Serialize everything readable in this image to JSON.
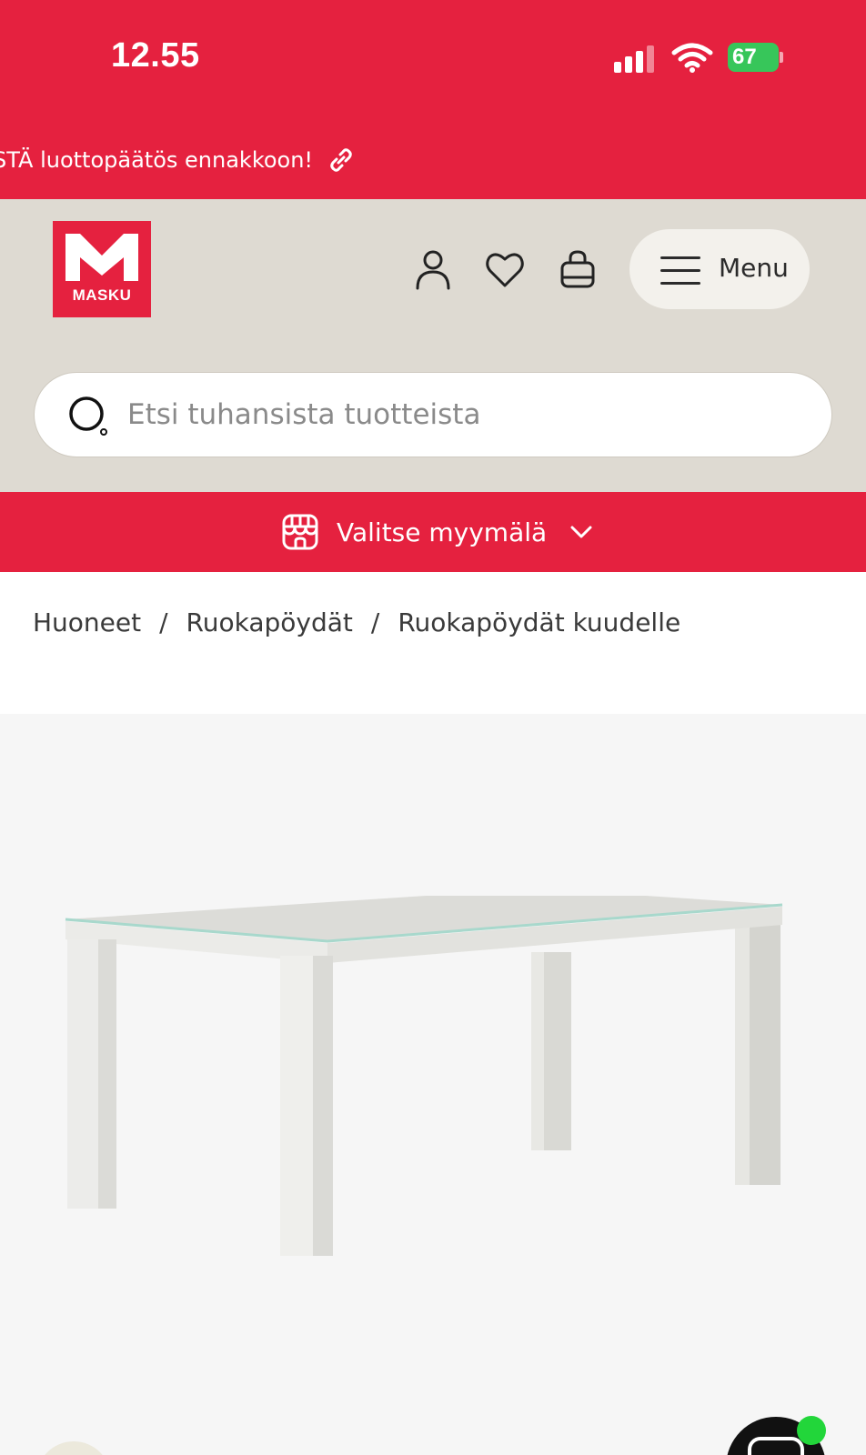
{
  "status_bar": {
    "time": "12.55",
    "battery": "67"
  },
  "promo": {
    "text": "STÄ luottopäätös ennakkoon!",
    "icon": "link-icon"
  },
  "header": {
    "logo_text": "MASKU",
    "icons": [
      "user-icon",
      "heart-icon",
      "bag-icon"
    ],
    "menu_label": "Menu"
  },
  "search": {
    "placeholder": "Etsi tuhansista tuotteista"
  },
  "store": {
    "label": "Valitse myymälä",
    "icon": "store-icon"
  },
  "breadcrumb": {
    "items": [
      "Huoneet",
      "Ruokapöydät",
      "Ruokapöydät kuudelle"
    ],
    "separator": "/"
  },
  "colors": {
    "brand_red": "#e5213f",
    "header_beige": "#dedad2",
    "chat_online": "#22d63a"
  }
}
